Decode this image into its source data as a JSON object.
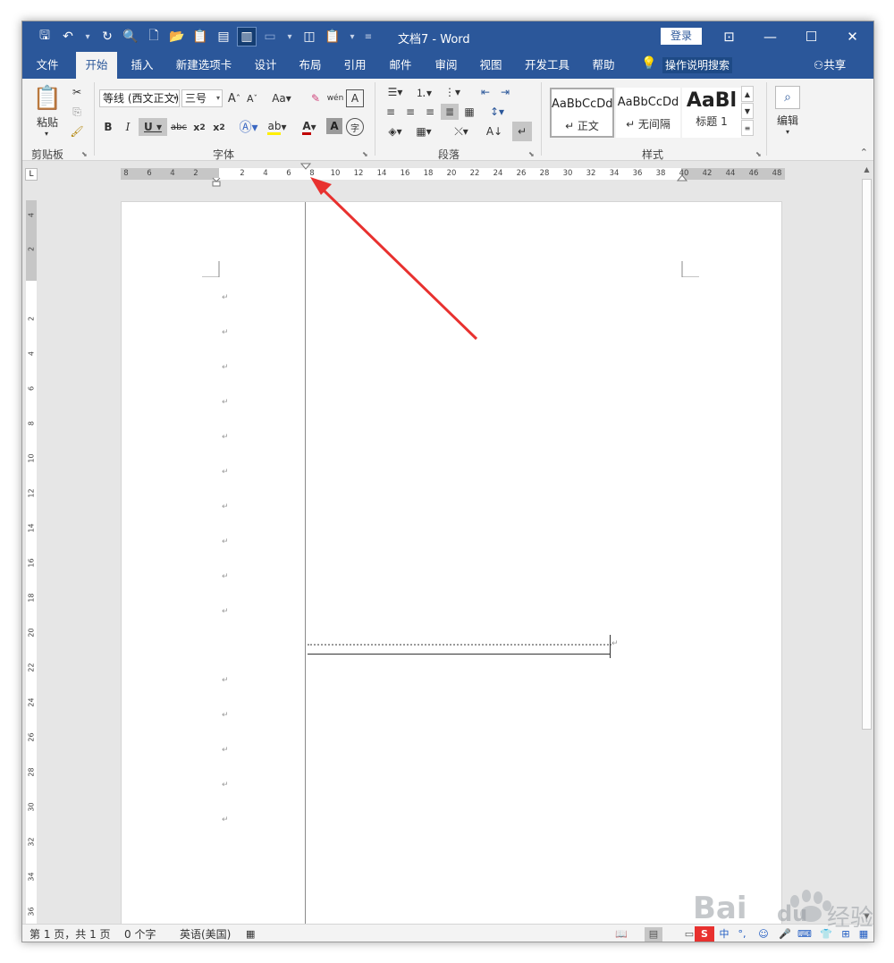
{
  "title": {
    "doc": "文档7  -  Word",
    "login": "登录"
  },
  "tabs": [
    {
      "label": "文件"
    },
    {
      "label": "开始"
    },
    {
      "label": "插入"
    },
    {
      "label": "新建选项卡"
    },
    {
      "label": "设计"
    },
    {
      "label": "布局"
    },
    {
      "label": "引用"
    },
    {
      "label": "邮件"
    },
    {
      "label": "审阅"
    },
    {
      "label": "视图"
    },
    {
      "label": "开发工具"
    },
    {
      "label": "帮助"
    }
  ],
  "tell_me": "操作说明搜索",
  "share": "共享",
  "ribbon": {
    "clipboard": {
      "label": "剪贴板",
      "paste": "粘贴"
    },
    "font": {
      "label": "字体",
      "font_name": "等线 (西文正文)",
      "font_size": "三号",
      "aa": "Aa"
    },
    "paragraph": {
      "label": "段落"
    },
    "styles": {
      "label": "样式",
      "items": [
        {
          "preview": "AaBbCcDd",
          "name": "↵ 正文"
        },
        {
          "preview": "AaBbCcDd",
          "name": "↵ 无间隔"
        },
        {
          "preview": "AaBl",
          "name": "标题 1"
        }
      ]
    },
    "editing": {
      "label": "编辑"
    }
  },
  "ruler": {
    "h_left": [
      "8",
      "6",
      "4",
      "2"
    ],
    "h_right": [
      "2",
      "4",
      "6",
      "8",
      "10",
      "12",
      "14",
      "16",
      "18",
      "20",
      "22",
      "24",
      "26",
      "28",
      "30",
      "32",
      "34",
      "36",
      "38",
      "40",
      "42",
      "44",
      "46",
      "48"
    ],
    "v_top": [
      "4",
      "2"
    ],
    "v": [
      "2",
      "4",
      "6",
      "8",
      "10",
      "12",
      "14",
      "16",
      "18",
      "20",
      "22",
      "24",
      "26",
      "28",
      "30",
      "32",
      "34",
      "36"
    ]
  },
  "paragraph_mark": "↵",
  "status": {
    "page": "第 1 页，共 1 页",
    "words": "0 个字",
    "lang": "英语(美国)"
  },
  "watermark": {
    "brand": "Bai",
    "brand2": "du",
    "cn": "经验"
  },
  "colors": {
    "accent": "#2b579a",
    "arrow": "#e8312f"
  }
}
